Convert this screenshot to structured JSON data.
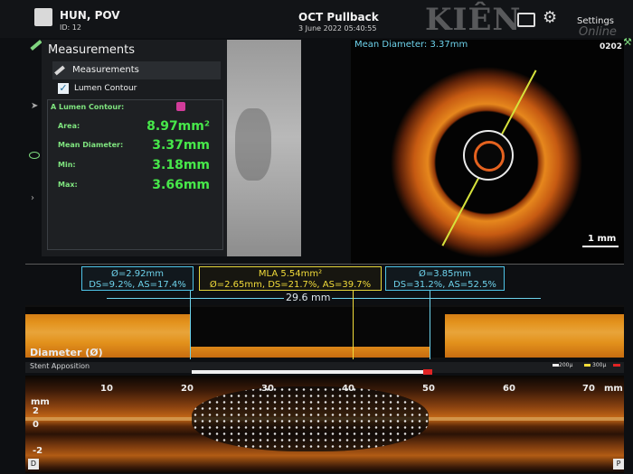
{
  "header": {
    "patient_name": "HUN, POV",
    "patient_id": "ID: 12",
    "study_title": "OCT Pullback",
    "study_date": "3 June 2022 05:40:55",
    "watermark": "KIÊN GIANG",
    "watermark_sub": "Online",
    "settings_label": "Settings"
  },
  "measurements": {
    "panel_title": "Measurements",
    "sub_title": "Measurements",
    "lumen_checkbox": "Lumen Contour",
    "box_title": "A Lumen Contour:",
    "rows": [
      {
        "label": "Area:",
        "value": "8.97mm²"
      },
      {
        "label": "Mean Diameter:",
        "value": "3.37mm"
      },
      {
        "label": "Min:",
        "value": "3.18mm"
      },
      {
        "label": "Max:",
        "value": "3.66mm"
      }
    ]
  },
  "oct_view": {
    "mean_diameter": "Mean Diameter: 3.37mm",
    "frame": "0202",
    "scale": "1 mm"
  },
  "profile": {
    "left_box": {
      "line1": "Ø=2.92mm",
      "line2": "DS=9.2%, AS=17.4%"
    },
    "mla_box": {
      "line1": "MLA 5.54mm²",
      "line2": "Ø=2.65mm, DS=21.7%, AS=39.7%"
    },
    "right_box": {
      "line1": "Ø=3.85mm",
      "line2": "DS=31.2%, AS=52.5%"
    },
    "length": "29.6 mm",
    "diameter_label": "Diameter (Ø)",
    "stent_label": "Stent Apposition",
    "legend": [
      "200µ",
      "300µ"
    ]
  },
  "longitudinal": {
    "ticks": [
      "10",
      "20",
      "30",
      "40",
      "50",
      "60",
      "70"
    ],
    "unit": "mm",
    "y_labels": [
      "2",
      "0",
      "-2"
    ],
    "left_badge": "D",
    "right_badge": "P"
  },
  "colors": {
    "accent_cyan": "#6ed3ec",
    "mla_yellow": "#f2dc3a",
    "value_green": "#47e84a",
    "oct_orange": "#e6871d"
  }
}
